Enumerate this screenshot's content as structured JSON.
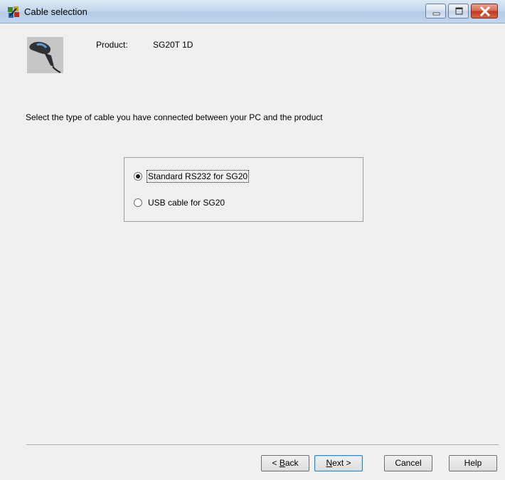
{
  "window": {
    "title": "Cable selection"
  },
  "product": {
    "label": "Product:",
    "value": "SG20T 1D"
  },
  "instruction": "Select the type of cable you have connected between your PC and the product",
  "cable_options": [
    {
      "label": "Standard RS232 for SG20",
      "selected": true
    },
    {
      "label": "USB cable for SG20",
      "selected": false
    }
  ],
  "buttons": {
    "back": {
      "prefix": "< ",
      "accel": "B",
      "rest": "ack"
    },
    "next": {
      "accel": "N",
      "rest": "ext >"
    },
    "cancel": "Cancel",
    "help": "Help"
  }
}
